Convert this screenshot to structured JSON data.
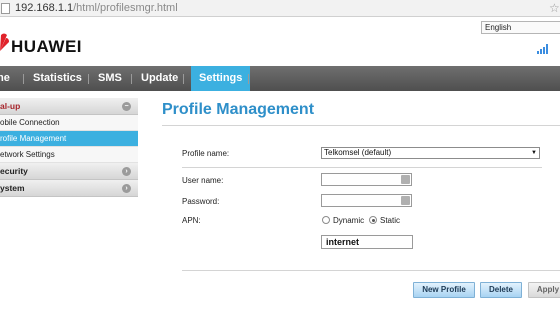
{
  "browser": {
    "url_host": "192.168.1.1",
    "url_path": "/html/profilesmgr.html"
  },
  "header": {
    "brand": "HUAWEI",
    "language": "English",
    "colors": {
      "brand_red": "#e0222a",
      "signal_blue": "#3b8de0"
    }
  },
  "nav": {
    "items": [
      {
        "label": "me"
      },
      {
        "label": "Statistics"
      },
      {
        "label": "SMS"
      },
      {
        "label": "Update"
      },
      {
        "label": "Settings"
      }
    ],
    "active_index": 4,
    "colors": {
      "bar": "#5c5c5c",
      "active": "#3cb0e0"
    }
  },
  "sidebar": {
    "sections": [
      {
        "label": "al-up",
        "items": [
          {
            "label": "obile Connection"
          },
          {
            "label": "rofile Management"
          },
          {
            "label": "etwork Settings"
          }
        ]
      },
      {
        "label": "ecurity"
      },
      {
        "label": "ystem"
      }
    ]
  },
  "main": {
    "title": "Profile Management",
    "profile_name_label": "Profile name:",
    "profile_name_value": "Telkomsel    (default)",
    "username_label": "User name:",
    "password_label": "Password:",
    "apn_label": "APN:",
    "apn_dynamic": "Dynamic",
    "apn_static": "Static",
    "apn_selected": "Static",
    "apn_value": "internet",
    "buttons": {
      "new_profile": "New Profile",
      "delete": "Delete",
      "apply": "Apply"
    }
  }
}
